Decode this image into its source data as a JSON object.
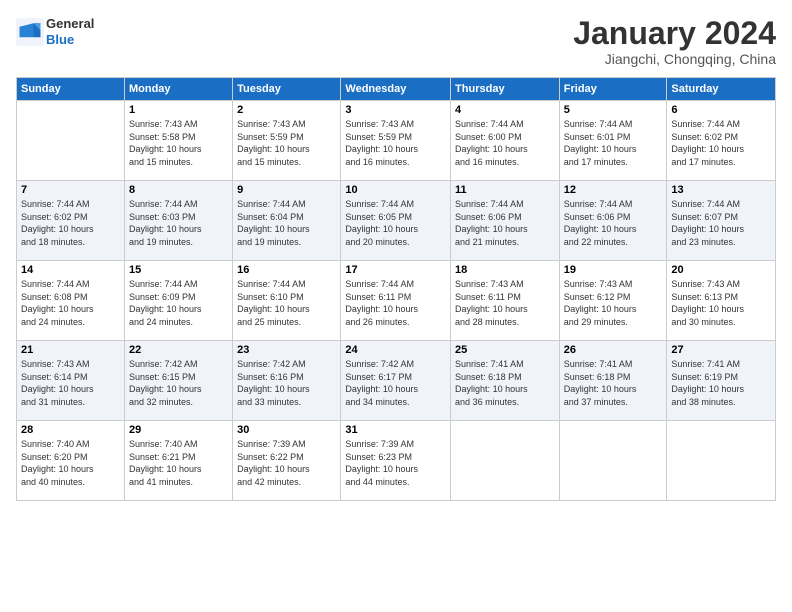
{
  "header": {
    "logo_general": "General",
    "logo_blue": "Blue",
    "title": "January 2024",
    "location": "Jiangchi, Chongqing, China"
  },
  "days_of_week": [
    "Sunday",
    "Monday",
    "Tuesday",
    "Wednesday",
    "Thursday",
    "Friday",
    "Saturday"
  ],
  "weeks": [
    [
      {
        "day": "",
        "info": ""
      },
      {
        "day": "1",
        "info": "Sunrise: 7:43 AM\nSunset: 5:58 PM\nDaylight: 10 hours\nand 15 minutes."
      },
      {
        "day": "2",
        "info": "Sunrise: 7:43 AM\nSunset: 5:59 PM\nDaylight: 10 hours\nand 15 minutes."
      },
      {
        "day": "3",
        "info": "Sunrise: 7:43 AM\nSunset: 5:59 PM\nDaylight: 10 hours\nand 16 minutes."
      },
      {
        "day": "4",
        "info": "Sunrise: 7:44 AM\nSunset: 6:00 PM\nDaylight: 10 hours\nand 16 minutes."
      },
      {
        "day": "5",
        "info": "Sunrise: 7:44 AM\nSunset: 6:01 PM\nDaylight: 10 hours\nand 17 minutes."
      },
      {
        "day": "6",
        "info": "Sunrise: 7:44 AM\nSunset: 6:02 PM\nDaylight: 10 hours\nand 17 minutes."
      }
    ],
    [
      {
        "day": "7",
        "info": "Sunrise: 7:44 AM\nSunset: 6:02 PM\nDaylight: 10 hours\nand 18 minutes."
      },
      {
        "day": "8",
        "info": "Sunrise: 7:44 AM\nSunset: 6:03 PM\nDaylight: 10 hours\nand 19 minutes."
      },
      {
        "day": "9",
        "info": "Sunrise: 7:44 AM\nSunset: 6:04 PM\nDaylight: 10 hours\nand 19 minutes."
      },
      {
        "day": "10",
        "info": "Sunrise: 7:44 AM\nSunset: 6:05 PM\nDaylight: 10 hours\nand 20 minutes."
      },
      {
        "day": "11",
        "info": "Sunrise: 7:44 AM\nSunset: 6:06 PM\nDaylight: 10 hours\nand 21 minutes."
      },
      {
        "day": "12",
        "info": "Sunrise: 7:44 AM\nSunset: 6:06 PM\nDaylight: 10 hours\nand 22 minutes."
      },
      {
        "day": "13",
        "info": "Sunrise: 7:44 AM\nSunset: 6:07 PM\nDaylight: 10 hours\nand 23 minutes."
      }
    ],
    [
      {
        "day": "14",
        "info": "Sunrise: 7:44 AM\nSunset: 6:08 PM\nDaylight: 10 hours\nand 24 minutes."
      },
      {
        "day": "15",
        "info": "Sunrise: 7:44 AM\nSunset: 6:09 PM\nDaylight: 10 hours\nand 24 minutes."
      },
      {
        "day": "16",
        "info": "Sunrise: 7:44 AM\nSunset: 6:10 PM\nDaylight: 10 hours\nand 25 minutes."
      },
      {
        "day": "17",
        "info": "Sunrise: 7:44 AM\nSunset: 6:11 PM\nDaylight: 10 hours\nand 26 minutes."
      },
      {
        "day": "18",
        "info": "Sunrise: 7:43 AM\nSunset: 6:11 PM\nDaylight: 10 hours\nand 28 minutes."
      },
      {
        "day": "19",
        "info": "Sunrise: 7:43 AM\nSunset: 6:12 PM\nDaylight: 10 hours\nand 29 minutes."
      },
      {
        "day": "20",
        "info": "Sunrise: 7:43 AM\nSunset: 6:13 PM\nDaylight: 10 hours\nand 30 minutes."
      }
    ],
    [
      {
        "day": "21",
        "info": "Sunrise: 7:43 AM\nSunset: 6:14 PM\nDaylight: 10 hours\nand 31 minutes."
      },
      {
        "day": "22",
        "info": "Sunrise: 7:42 AM\nSunset: 6:15 PM\nDaylight: 10 hours\nand 32 minutes."
      },
      {
        "day": "23",
        "info": "Sunrise: 7:42 AM\nSunset: 6:16 PM\nDaylight: 10 hours\nand 33 minutes."
      },
      {
        "day": "24",
        "info": "Sunrise: 7:42 AM\nSunset: 6:17 PM\nDaylight: 10 hours\nand 34 minutes."
      },
      {
        "day": "25",
        "info": "Sunrise: 7:41 AM\nSunset: 6:18 PM\nDaylight: 10 hours\nand 36 minutes."
      },
      {
        "day": "26",
        "info": "Sunrise: 7:41 AM\nSunset: 6:18 PM\nDaylight: 10 hours\nand 37 minutes."
      },
      {
        "day": "27",
        "info": "Sunrise: 7:41 AM\nSunset: 6:19 PM\nDaylight: 10 hours\nand 38 minutes."
      }
    ],
    [
      {
        "day": "28",
        "info": "Sunrise: 7:40 AM\nSunset: 6:20 PM\nDaylight: 10 hours\nand 40 minutes."
      },
      {
        "day": "29",
        "info": "Sunrise: 7:40 AM\nSunset: 6:21 PM\nDaylight: 10 hours\nand 41 minutes."
      },
      {
        "day": "30",
        "info": "Sunrise: 7:39 AM\nSunset: 6:22 PM\nDaylight: 10 hours\nand 42 minutes."
      },
      {
        "day": "31",
        "info": "Sunrise: 7:39 AM\nSunset: 6:23 PM\nDaylight: 10 hours\nand 44 minutes."
      },
      {
        "day": "",
        "info": ""
      },
      {
        "day": "",
        "info": ""
      },
      {
        "day": "",
        "info": ""
      }
    ]
  ]
}
